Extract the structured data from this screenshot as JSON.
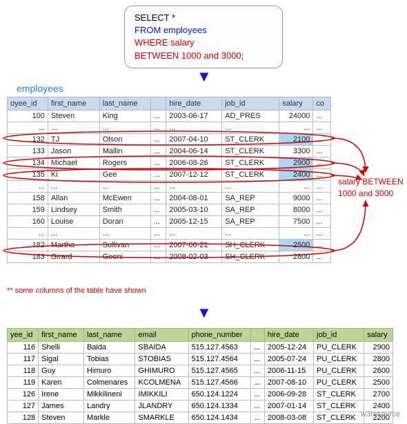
{
  "sql": {
    "select": "SELECT *",
    "from": "FROM employees",
    "where": "WHERE salary",
    "between": "BETWEEN 1000 and 3000",
    "semicolon": ";"
  },
  "table_label": "employees",
  "note": "** some columns of the table have shown",
  "between_label_l1": "salary BETWEEN",
  "between_label_l2": "1000  and 3000",
  "emp": {
    "headers": {
      "c0": "oyee_id",
      "c1": "first_name",
      "c2": "last_name",
      "c4": "hire_date",
      "c5": "job_id",
      "c6": "salary",
      "c7": "co"
    },
    "rows": [
      {
        "id": "100",
        "fn": "Steven",
        "ln": "King",
        "hd": "2003-06-17",
        "job": "AD_PRES",
        "sal": "24000",
        "hl": false
      },
      {
        "dots": true
      },
      {
        "id": "132",
        "fn": "TJ",
        "ln": "Olson",
        "hd": "2007-04-10",
        "job": "ST_CLERK",
        "sal": "2100",
        "hl": true
      },
      {
        "id": "133",
        "fn": "Jason",
        "ln": "Mallin",
        "hd": "2004-06-14",
        "job": "ST_CLERK",
        "sal": "3300",
        "hl": false
      },
      {
        "id": "134",
        "fn": "Michael",
        "ln": "Rogers",
        "hd": "2006-08-26",
        "job": "ST_CLERK",
        "sal": "2900",
        "hl": true
      },
      {
        "id": "135",
        "fn": "Ki",
        "ln": "Gee",
        "hd": "2007-12-12",
        "job": "ST_CLERK",
        "sal": "2400",
        "hl": true
      },
      {
        "dots": true
      },
      {
        "id": "158",
        "fn": "Allan",
        "ln": "McEwen",
        "hd": "2004-08-01",
        "job": "SA_REP",
        "sal": "9000",
        "hl": false
      },
      {
        "id": "159",
        "fn": "Lindsey",
        "ln": "Smith",
        "hd": "2005-03-10",
        "job": "SA_REP",
        "sal": "8000",
        "hl": false
      },
      {
        "id": "160",
        "fn": "Louise",
        "ln": "Doran",
        "hd": "2005-12-15",
        "job": "SA_REP",
        "sal": "7500",
        "hl": false
      },
      {
        "dots": true
      },
      {
        "id": "182",
        "fn": "Martha",
        "ln": "Sullivan",
        "hd": "2007-06-21",
        "job": "SH_CLERK",
        "sal": "2500",
        "hl": true
      },
      {
        "id": "183",
        "fn": "Girard",
        "ln": "Geoni",
        "hd": "2008-02-03",
        "job": "SH_CLERK",
        "sal": "2800",
        "hl": false,
        "cut": true
      }
    ]
  },
  "result": {
    "headers": {
      "c0": "yee_id",
      "c1": "first_name",
      "c2": "last_name",
      "c3": "email",
      "c4": "phone_number",
      "c6": "hire_date",
      "c7": "job_id",
      "c8": "salary"
    },
    "rows": [
      {
        "id": "116",
        "fn": "Shelli",
        "ln": "Baida",
        "em": "SBAIDA",
        "ph": "515.127.4563",
        "hd": "2005-12-24",
        "job": "PU_CLERK",
        "sal": "2900"
      },
      {
        "id": "117",
        "fn": "Sigal",
        "ln": "Tobias",
        "em": "STOBIAS",
        "ph": "515.127.4564",
        "hd": "2005-07-24",
        "job": "PU_CLERK",
        "sal": "2800"
      },
      {
        "id": "118",
        "fn": "Guy",
        "ln": "Himuro",
        "em": "GHIMURO",
        "ph": "515.127.4565",
        "hd": "2006-11-15",
        "job": "PU_CLERK",
        "sal": "2600"
      },
      {
        "id": "119",
        "fn": "Karen",
        "ln": "Colmenares",
        "em": "KCOLMENA",
        "ph": "515.127.4566",
        "hd": "2007-08-10",
        "job": "PU_CLERK",
        "sal": "2500"
      },
      {
        "id": "126",
        "fn": "Irene",
        "ln": "Mikkilineni",
        "em": "IMIKKILI",
        "ph": "650.124.1224",
        "hd": "2006-09-28",
        "job": "ST_CLERK",
        "sal": "2700"
      },
      {
        "id": "127",
        "fn": "James",
        "ln": "Landry",
        "em": "JLANDRY",
        "ph": "650.124.1334",
        "hd": "2007-01-14",
        "job": "ST_CLERK",
        "sal": "2400"
      },
      {
        "id": "128",
        "fn": "Steven",
        "ln": "Markle",
        "em": "SMARKLE",
        "ph": "650.124.1434",
        "hd": "2008-03-08",
        "job": "ST_CLERK",
        "sal": "2200"
      }
    ]
  },
  "watermark": "w3resource"
}
